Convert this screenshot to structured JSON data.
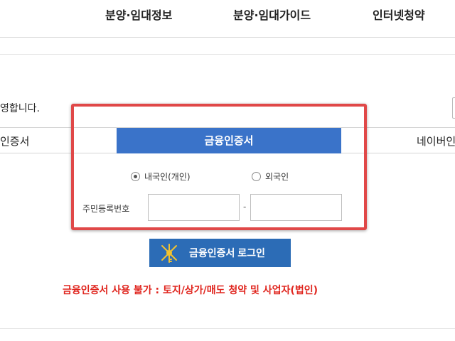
{
  "nav": {
    "items": [
      "분양·임대정보",
      "분양·임대가이드",
      "인터넷청약"
    ]
  },
  "notice_text": "영합니다.",
  "tabs": {
    "left_label": "인증서",
    "active_label": "금융인증서",
    "right_label": "네이버인"
  },
  "form": {
    "radio_domestic_label": "내국인(개인)",
    "radio_foreign_label": "외국인",
    "selected": "내국인(개인)",
    "id_label": "주민등록번호",
    "separator": "-",
    "id_front_value": "",
    "id_back_value": ""
  },
  "login_button_label": "금융인증서 로그인",
  "warning_text": "금융인증서 사용 불가 : 토지/상가/매도 청약 및 사업자(법인)",
  "colors": {
    "tab_active": "#3a73c9",
    "login_button": "#2c6cb6",
    "warning": "#e0261f",
    "highlight_border": "#e04848"
  },
  "icons": {
    "login": "key-icon",
    "logo": "logo-arc"
  }
}
